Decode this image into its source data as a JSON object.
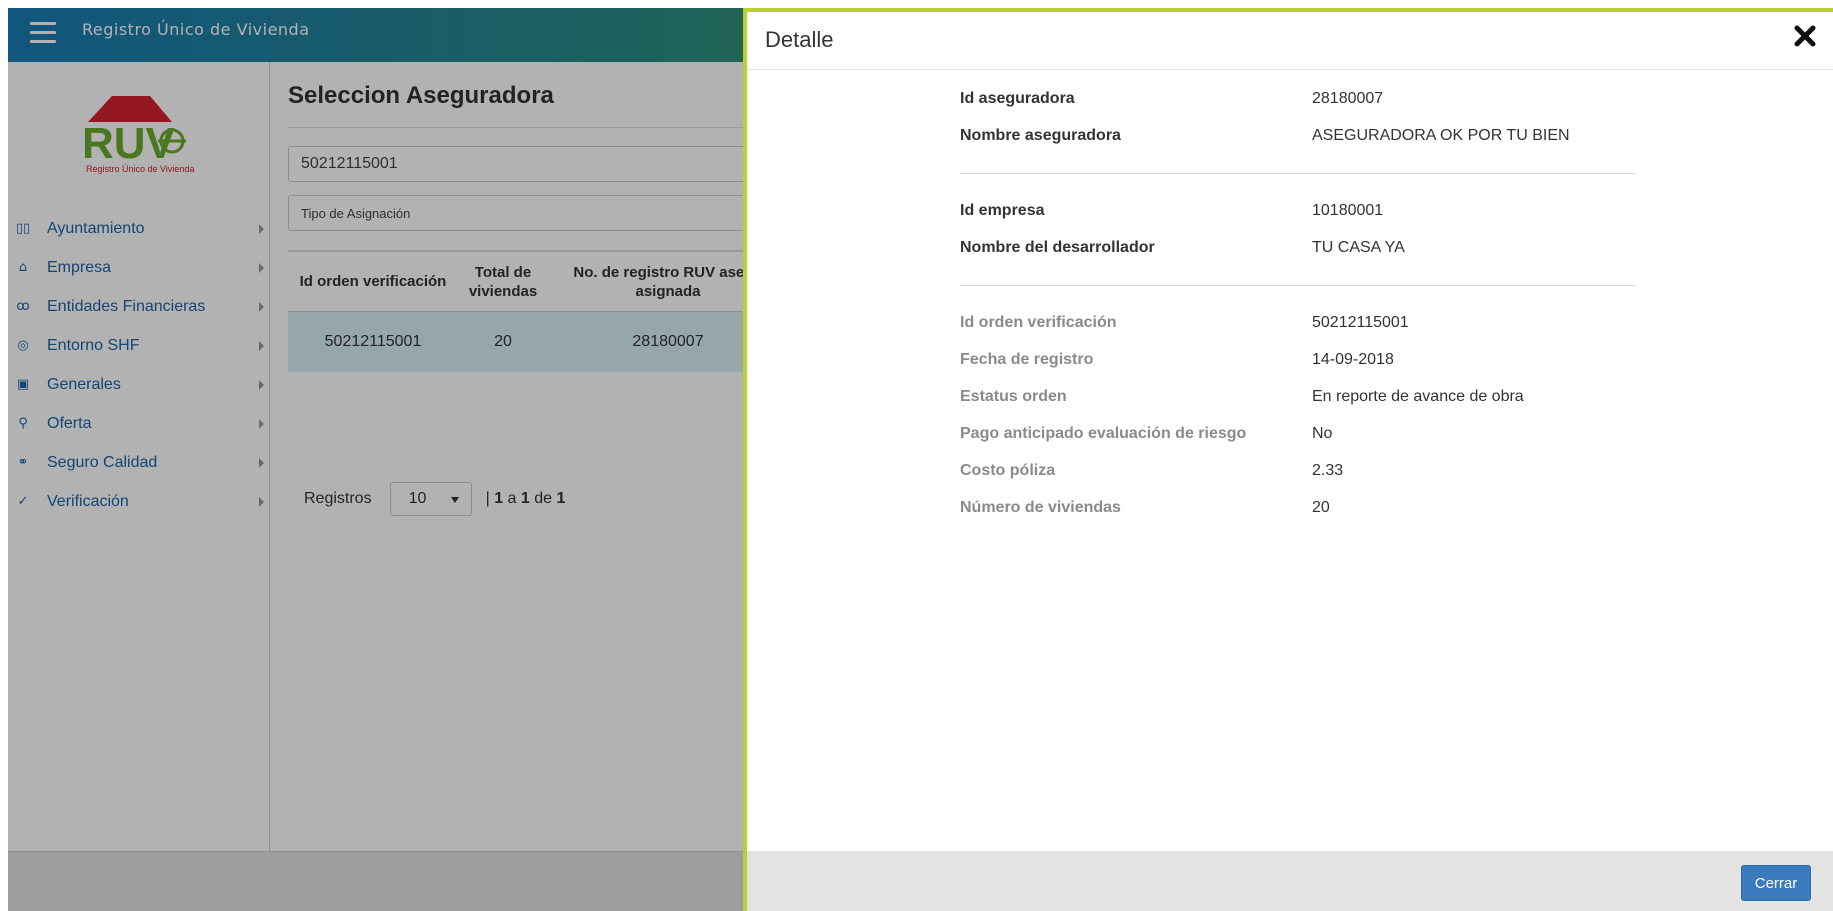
{
  "app": {
    "title": "Registro Único de Vivienda"
  },
  "logo": {
    "brand": "RUV",
    "tagline": "Registro Único de Vivienda"
  },
  "sidebar": {
    "items": [
      {
        "label": "Ayuntamiento",
        "icon": "map-icon"
      },
      {
        "label": "Empresa",
        "icon": "building-icon"
      },
      {
        "label": "Entidades Financieras",
        "icon": "people-icon"
      },
      {
        "label": "Entorno SHF",
        "icon": "target-icon"
      },
      {
        "label": "Generales",
        "icon": "document-icon"
      },
      {
        "label": "Oferta",
        "icon": "person-icon"
      },
      {
        "label": "Seguro Calidad",
        "icon": "handshake-icon"
      },
      {
        "label": "Verificación",
        "icon": "check-circle-icon"
      }
    ]
  },
  "main": {
    "title": "Seleccion Aseguradora",
    "search_value": "50212115001",
    "asignacion_placeholder": "Tipo de Asignación",
    "table": {
      "headers": [
        "Id orden verificación",
        "Total de viviendas",
        "No. de registro RUV asegu asignada"
      ],
      "rows": [
        [
          "50212115001",
          "20",
          "28180007"
        ]
      ]
    },
    "pager": {
      "label": "Registros",
      "page_size": "10",
      "info_prefix": "| ",
      "from": "1",
      "a": " a ",
      "to": "1",
      "de": " de ",
      "total": "1"
    }
  },
  "modal": {
    "title": "Detalle",
    "rows": [
      {
        "label": "Id aseguradora",
        "value": "28180007"
      },
      {
        "label": "Nombre aseguradora",
        "value": "ASEGURADORA OK POR TU BIEN"
      },
      {
        "label": "Id empresa",
        "value": "10180001"
      },
      {
        "label": "Nombre del desarrollador",
        "value": "TU CASA YA"
      },
      {
        "label": "Id orden verificación",
        "value": "50212115001"
      },
      {
        "label": "Fecha de registro",
        "value": "14-09-2018"
      },
      {
        "label": "Estatus orden",
        "value": "En reporte de avance de obra"
      },
      {
        "label": "Pago anticipado evaluación de riesgo",
        "value": "No"
      },
      {
        "label": "Costo póliza",
        "value": "2.33"
      },
      {
        "label": "Número de viviendas",
        "value": "20"
      }
    ],
    "close_label": "Cerrar"
  },
  "colors": {
    "accent": "#b6d22c",
    "link": "#1c64a8",
    "button": "#3a7bbd"
  }
}
